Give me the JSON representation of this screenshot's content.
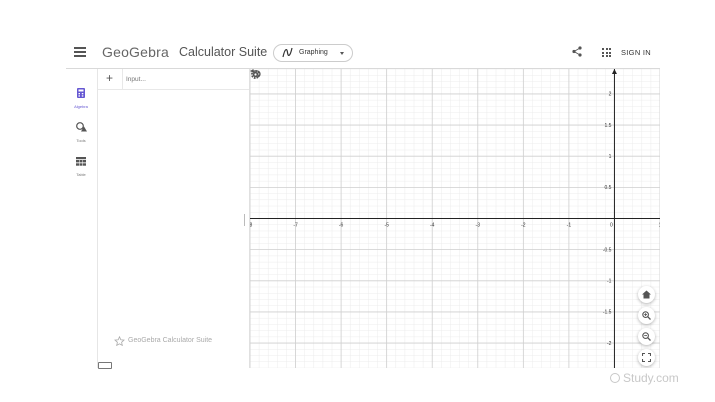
{
  "header": {
    "logo": "GeoGebra",
    "suite_title": "Calculator Suite",
    "app_selector": {
      "label": "Graphing"
    },
    "sign_in_label": "SIGN IN"
  },
  "sidebar": {
    "items": [
      {
        "label": "Algebra",
        "icon": "algebra-calculator-icon",
        "active": true
      },
      {
        "label": "Tools",
        "icon": "tools-shapes-icon",
        "active": false
      },
      {
        "label": "Table",
        "icon": "table-icon",
        "active": false
      }
    ]
  },
  "algebra_view": {
    "input_placeholder": "Input...",
    "footer_label": "GeoGebra Calculator Suite"
  },
  "graph": {
    "x_range": [
      -8,
      1
    ],
    "y_range": [
      -2.4,
      2.4
    ],
    "x_ticks": [
      "-8",
      "-7",
      "-6",
      "-5",
      "-4",
      "-3",
      "-2",
      "-1",
      "0",
      "1"
    ],
    "y_ticks": [
      "2",
      "1.5",
      "1",
      "0.5",
      "-0.5",
      "-1",
      "-1.5",
      "-2"
    ],
    "grid": true,
    "controls": [
      "home-icon",
      "zoom-in-icon",
      "zoom-out-icon",
      "fullscreen-icon"
    ]
  },
  "watermark": "Study.com",
  "colors": {
    "accent": "#6557d2",
    "grid_major": "#cfcfcf",
    "grid_minor": "#ececec",
    "axis": "#222222"
  }
}
